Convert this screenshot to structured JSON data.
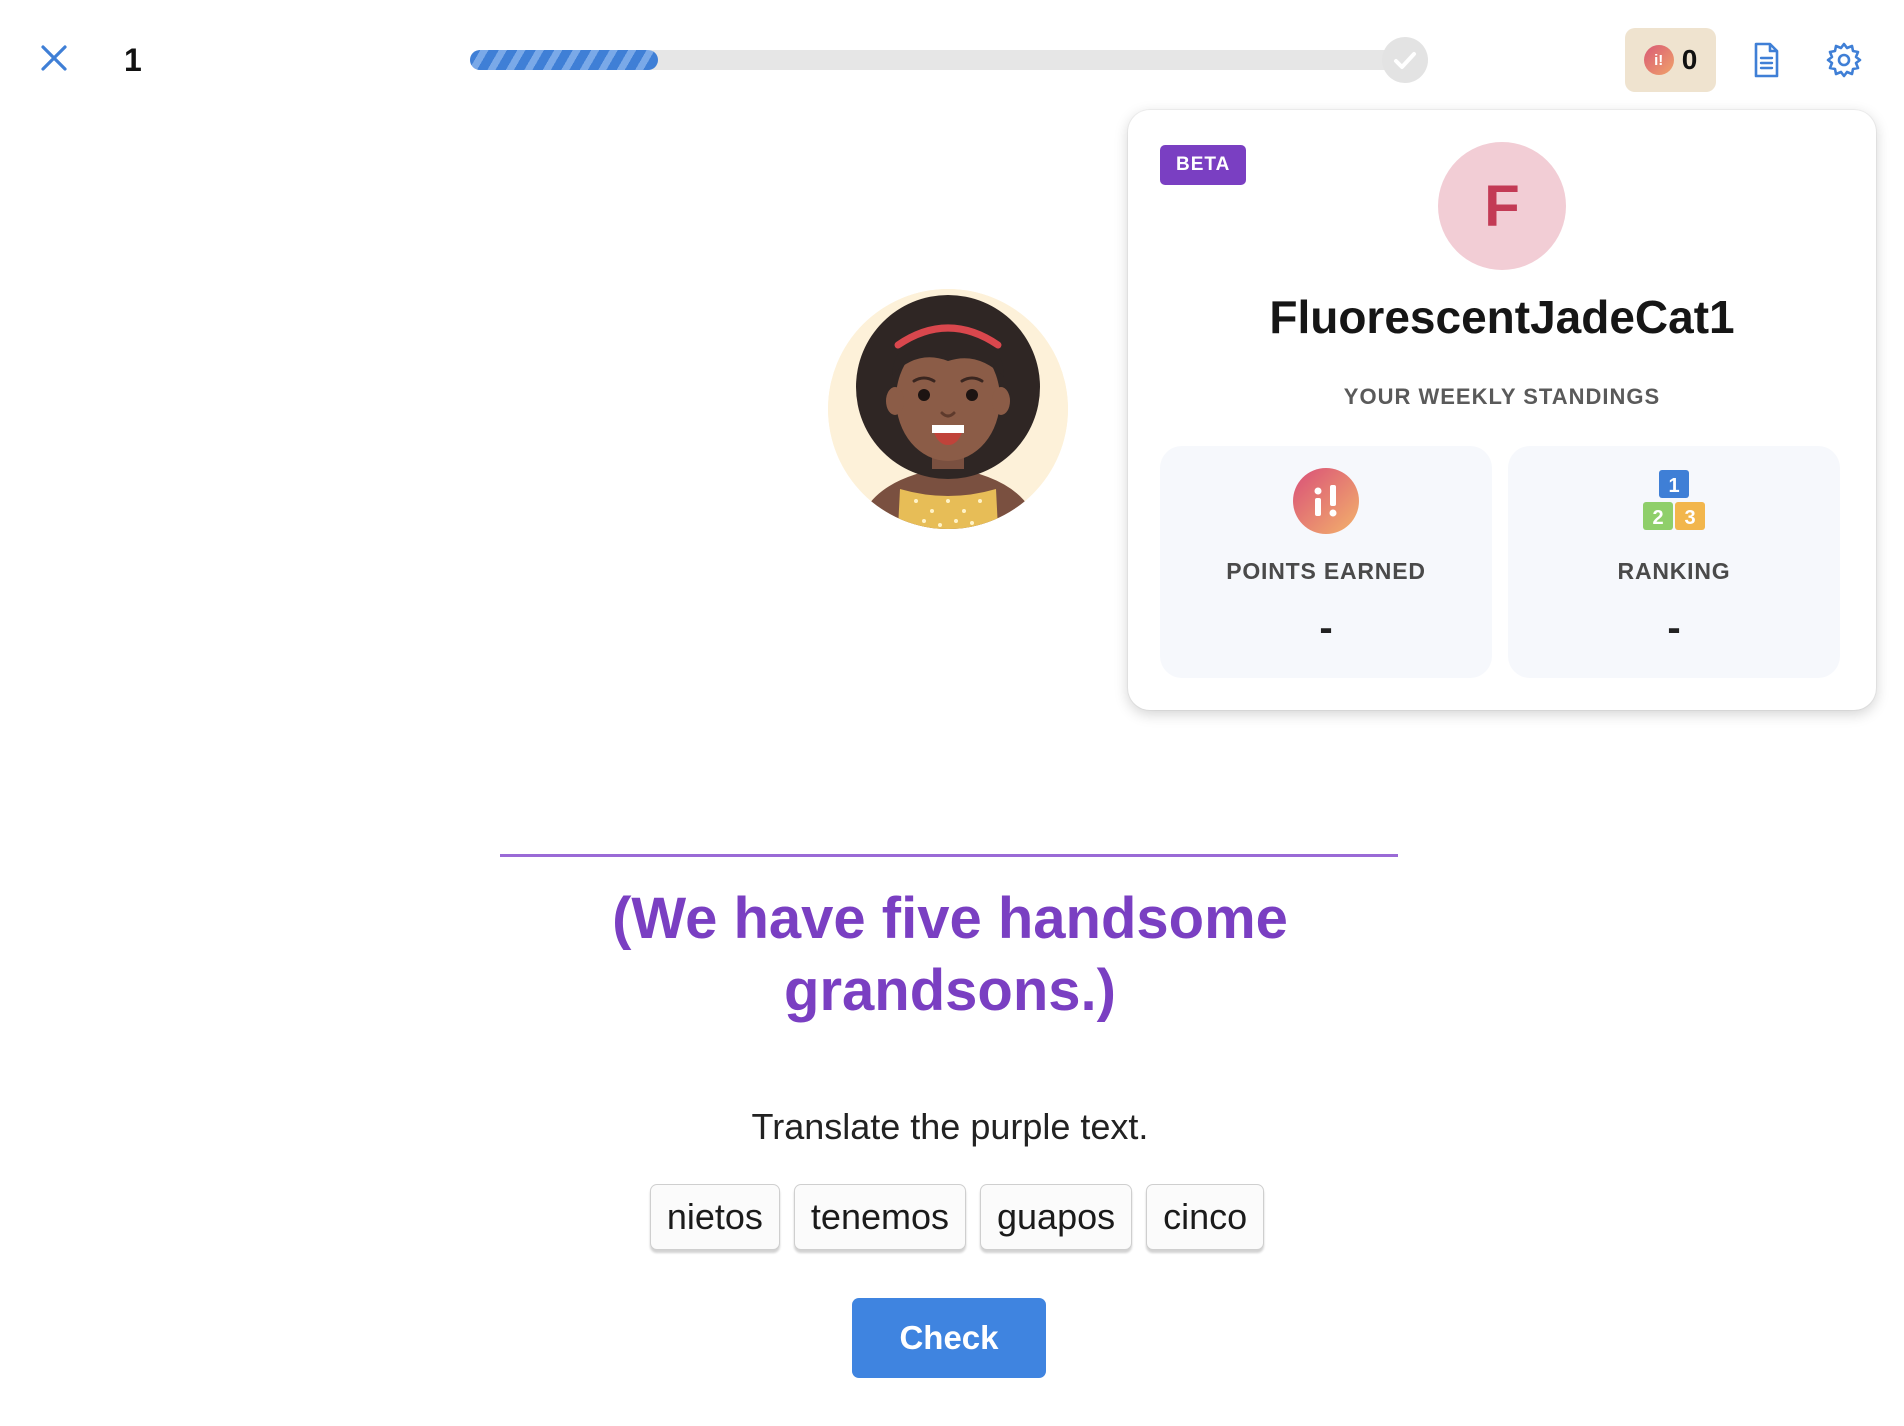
{
  "header": {
    "lesson_count": "1",
    "progress_fraction": 0.2,
    "points_count": "0",
    "icons": {
      "close": "close-icon",
      "points": "points-icon",
      "notes": "document-icon",
      "settings": "gear-icon"
    }
  },
  "popover": {
    "badge": "BETA",
    "avatar_initial": "F",
    "username": "FluorescentJadeCat1",
    "section_title": "YOUR WEEKLY STANDINGS",
    "stats": [
      {
        "label": "POINTS EARNED",
        "value": "-"
      },
      {
        "label": "RANKING",
        "value": "-"
      }
    ],
    "ranking_digits": [
      "1",
      "2",
      "3"
    ]
  },
  "exercise": {
    "prompt": "(We have five handsome grandsons.)",
    "instruction": "Translate the purple text.",
    "words": [
      "nietos",
      "tenemos",
      "guapos",
      "cinco"
    ],
    "check_label": "Check"
  },
  "colors": {
    "accent_blue": "#3f84e0",
    "prompt_purple": "#7a3fc2",
    "beta_purple": "#7a3fc2",
    "avatar_red": "#c33a55"
  }
}
